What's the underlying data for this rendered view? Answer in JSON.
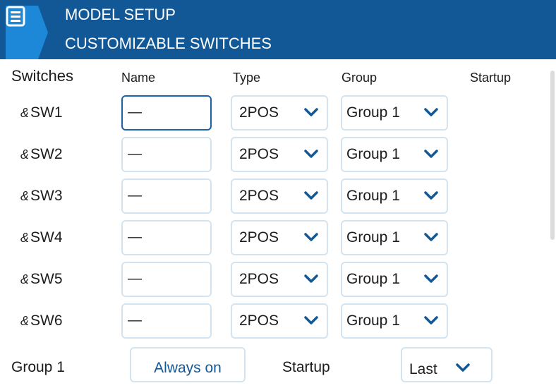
{
  "header": {
    "title": "MODEL SETUP",
    "subtitle": "CUSTOMIZABLE SWITCHES",
    "background": "#135896",
    "menu_icon": "menu-icon"
  },
  "columns": {
    "switches": "Switches",
    "name": "Name",
    "type": "Type",
    "group": "Group",
    "startup": "Startup"
  },
  "switch_icon": "&",
  "rows": [
    {
      "label": "SW1",
      "name": "—",
      "type": "2POS",
      "group": "Group 1"
    },
    {
      "label": "SW2",
      "name": "—",
      "type": "2POS",
      "group": "Group 1"
    },
    {
      "label": "SW3",
      "name": "—",
      "type": "2POS",
      "group": "Group 1"
    },
    {
      "label": "SW4",
      "name": "—",
      "type": "2POS",
      "group": "Group 1"
    },
    {
      "label": "SW5",
      "name": "—",
      "type": "2POS",
      "group": "Group 1"
    },
    {
      "label": "SW6",
      "name": "—",
      "type": "2POS",
      "group": "Group 1"
    }
  ],
  "group_section": {
    "label": "Group 1",
    "mode_button": "Always on",
    "startup_label": "Startup",
    "startup_value": "Last"
  },
  "colors": {
    "accent": "#1a63a8",
    "field_border": "#d3e4f0"
  }
}
